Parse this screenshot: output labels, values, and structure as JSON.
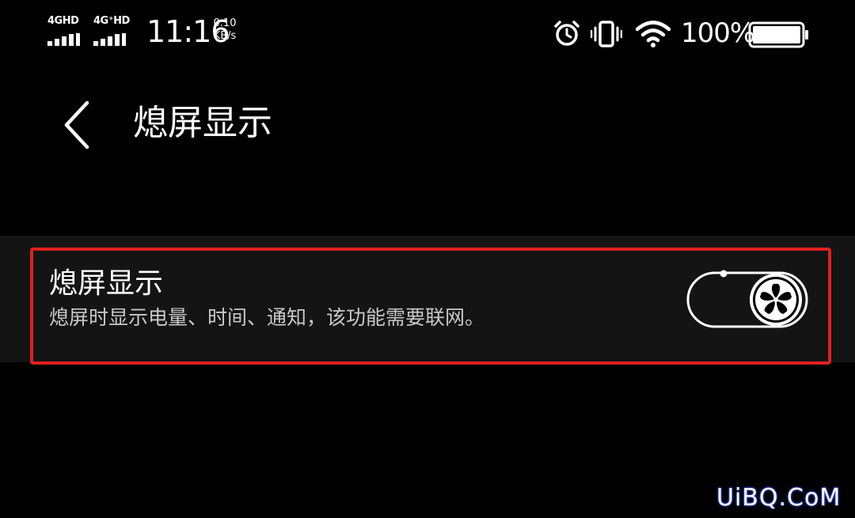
{
  "status_bar": {
    "sim1_label": "4GHD",
    "sim2_label": "4G⁺HD",
    "time": "11:16",
    "speed_value": "0.10",
    "speed_unit": "KB/s",
    "battery_percent": "100%",
    "icons": [
      "alarm-icon",
      "vibrate-icon",
      "wifi-icon",
      "battery-icon"
    ]
  },
  "header": {
    "title": "熄屏显示",
    "back_icon": "chevron-left-icon"
  },
  "setting": {
    "title": "熄屏显示",
    "description": "熄屏时显示电量、时间、通知，该功能需要联网。",
    "toggle_state": "on",
    "toggle_icon": "flower-icon"
  },
  "colors": {
    "background": "#000000",
    "row_background": "#141414",
    "highlight_border": "#e02020",
    "secondary_text": "#c8c8c8"
  },
  "watermark": "UiBQ.CoM"
}
